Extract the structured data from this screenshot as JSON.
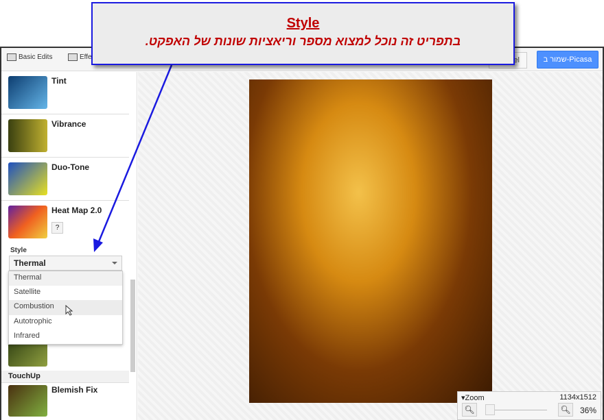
{
  "callout": {
    "title": "Style",
    "text": "בתפריט זה נוכל למצוא מספר וריאציות שונות של האפקט."
  },
  "toolbar": {
    "tabs": [
      "Basic Edits",
      "Effects"
    ],
    "cancel": "Cancel",
    "save": "שמור ב-Picasa"
  },
  "effects": [
    {
      "name": "Tint",
      "colors": [
        "#1a6fb0",
        "#64b5e8"
      ]
    },
    {
      "name": "Vibrance",
      "colors": [
        "#4d5a1a",
        "#c0b030"
      ]
    },
    {
      "name": "Duo-Tone",
      "colors": [
        "#1e50c0",
        "#e8e020"
      ]
    },
    {
      "name": "Heat Map 2.0",
      "colors": [
        "#6020a0",
        "#f06020"
      ],
      "help": "?"
    }
  ],
  "style": {
    "label": "Style",
    "selected": "Thermal",
    "options": [
      "Thermal",
      "Satellite",
      "Combustion",
      "Autotrophic",
      "Infrared"
    ],
    "hovered": "Combustion"
  },
  "touchup": {
    "section": "TouchUp",
    "items": [
      {
        "name": "Blemish Fix"
      }
    ]
  },
  "zoom": {
    "label": "Zoom",
    "resolution": "1134x1512",
    "percent": "36%",
    "minus": "−",
    "plus": "+",
    "level": 0.36
  }
}
